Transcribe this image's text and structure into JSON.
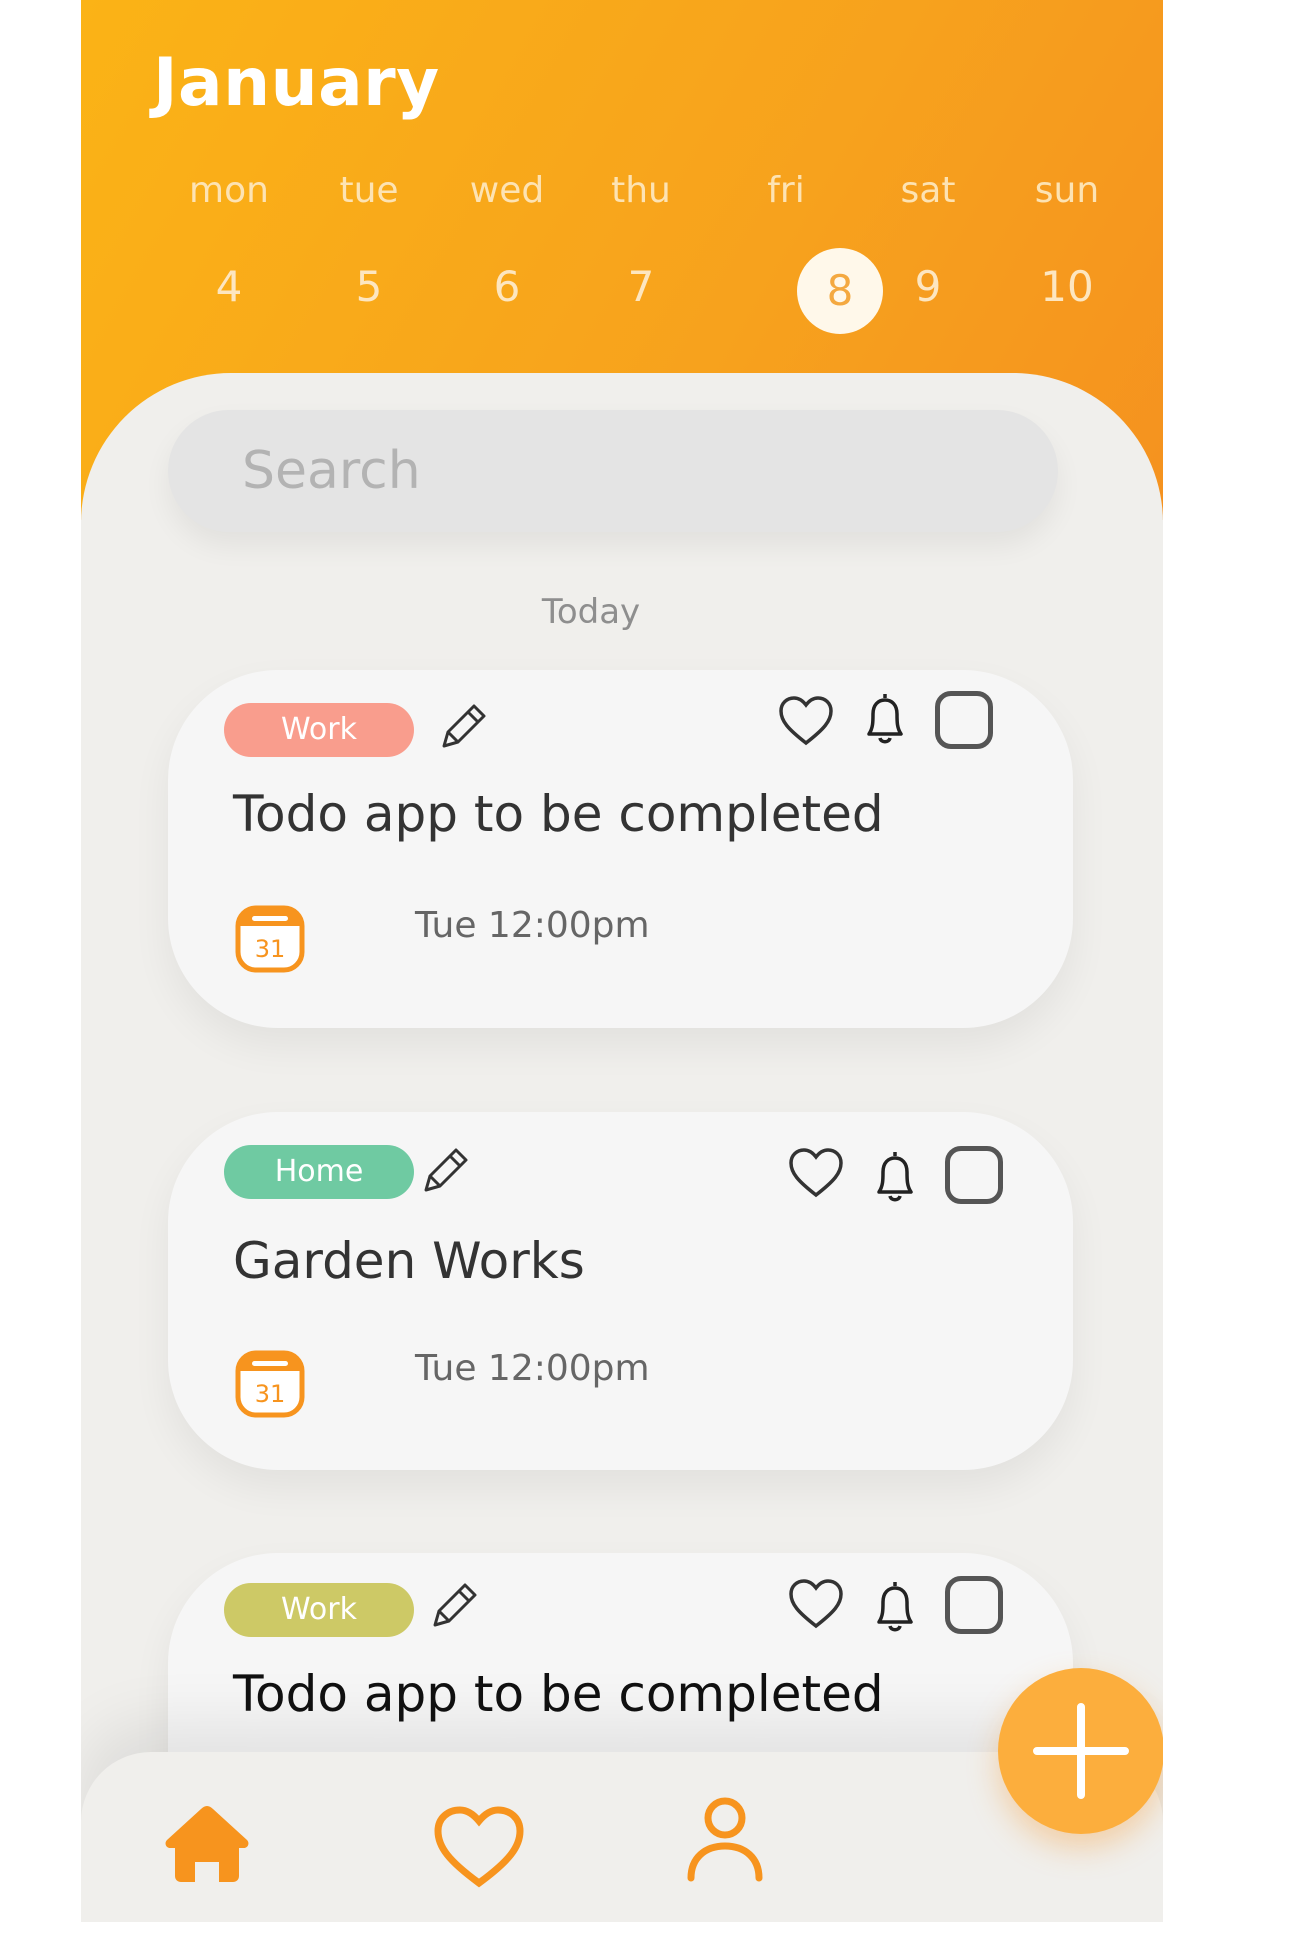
{
  "header": {
    "month": "January",
    "days": [
      {
        "name": "mon",
        "num": "4"
      },
      {
        "name": "tue",
        "num": "5"
      },
      {
        "name": "wed",
        "num": "6"
      },
      {
        "name": "thu",
        "num": "7"
      },
      {
        "name": "fri",
        "num": "8",
        "selected": true
      },
      {
        "name": "sat",
        "num": "9"
      },
      {
        "name": "sun",
        "num": "10"
      }
    ]
  },
  "search": {
    "placeholder": "Search"
  },
  "section": {
    "title": "Today"
  },
  "tasks": [
    {
      "tag": "Work",
      "tag_color": "#f99d8d",
      "title": "Todo app to be completed",
      "due": "Tue 12:00pm",
      "calendar_day": "31"
    },
    {
      "tag": "Home",
      "tag_color": "#6fcaa2",
      "title": "Garden Works",
      "due": "Tue 12:00pm",
      "calendar_day": "31"
    },
    {
      "tag": "Work",
      "tag_color": "#cdc966",
      "title": "Todo app to be completed"
    }
  ],
  "colors": {
    "accent": "#f7a21d",
    "fab": "#fcae3d",
    "nav_icon": "#f7941e"
  },
  "nav": {
    "items": [
      {
        "icon": "home-icon",
        "active": true
      },
      {
        "icon": "heart-icon"
      },
      {
        "icon": "profile-icon"
      }
    ],
    "fab_icon": "plus-icon"
  }
}
